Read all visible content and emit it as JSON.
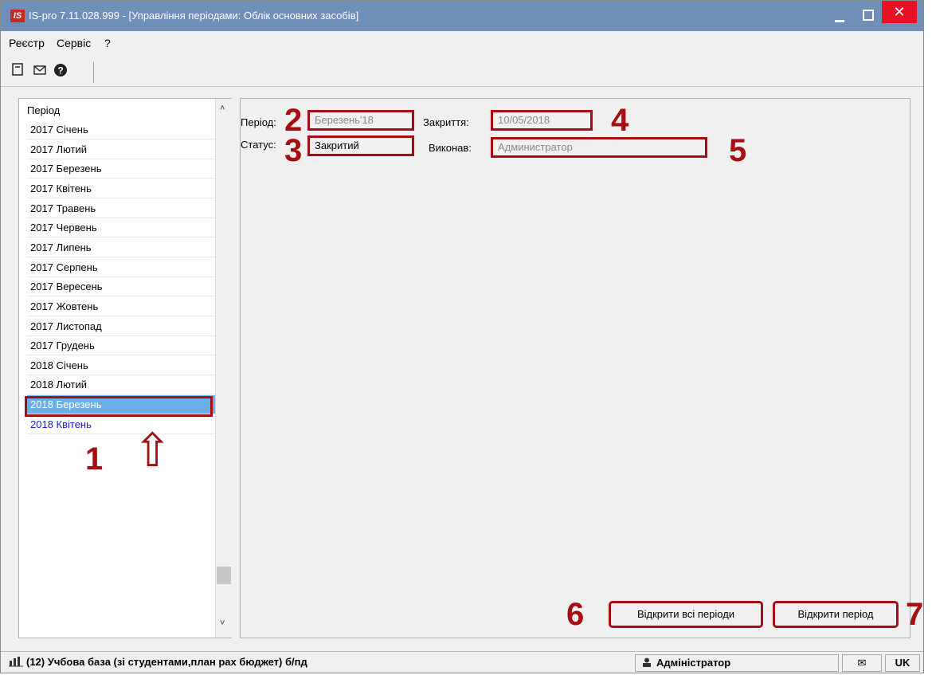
{
  "window": {
    "app_icon": "IS",
    "title": "IS-pro 7.11.028.999 - [Управління періодами: Облік основних засобів]",
    "controls": {
      "minimize": "minimize-icon",
      "maximize": "maximize-icon",
      "close": "✕"
    }
  },
  "menu": {
    "items": [
      "Реєстр",
      "Сервіс",
      "?"
    ]
  },
  "toolbar": {
    "icons": [
      "new-document-icon",
      "mail-icon",
      "help-icon"
    ]
  },
  "period_list": {
    "header": "Період",
    "items": [
      "2017 Січень",
      "2017 Лютий",
      "2017 Березень",
      "2017 Квітень",
      "2017 Травень",
      "2017 Червень",
      "2017 Липень",
      "2017 Серпень",
      "2017 Вересень",
      "2017 Жовтень",
      "2017 Листопад",
      "2017 Грудень",
      "2018 Січень",
      "2018 Лютий",
      "2018 Березень",
      "2018 Квітень"
    ],
    "selected_index": 14,
    "scroll_up": "˄",
    "scroll_down": "˅"
  },
  "details": {
    "period_label": "Період:",
    "period_value": "Березень'18",
    "closing_label": "Закриття:",
    "closing_value": "10/05/2018",
    "status_label": "Статус:",
    "status_value": "Закритий",
    "executed_label": "Виконав:",
    "executed_value": "Администратор"
  },
  "actions": {
    "open_all": "Відкрити всі періоди",
    "open_period": "Відкрити період"
  },
  "callouts": {
    "c1": "1",
    "c2": "2",
    "c3": "3",
    "c4": "4",
    "c5": "5",
    "c6": "6",
    "c7": "7",
    "arrow": "⇧"
  },
  "statusbar": {
    "database": "(12) Учбова база (зі студентами,план рах бюджет) б/пд",
    "user": "Адміністратор",
    "lang": "UK",
    "mail": "✉"
  },
  "colors": {
    "titlebar": "#6f8fb8",
    "selection": "#6aaee8",
    "annotation": "#a50f12",
    "close": "#e81123"
  }
}
